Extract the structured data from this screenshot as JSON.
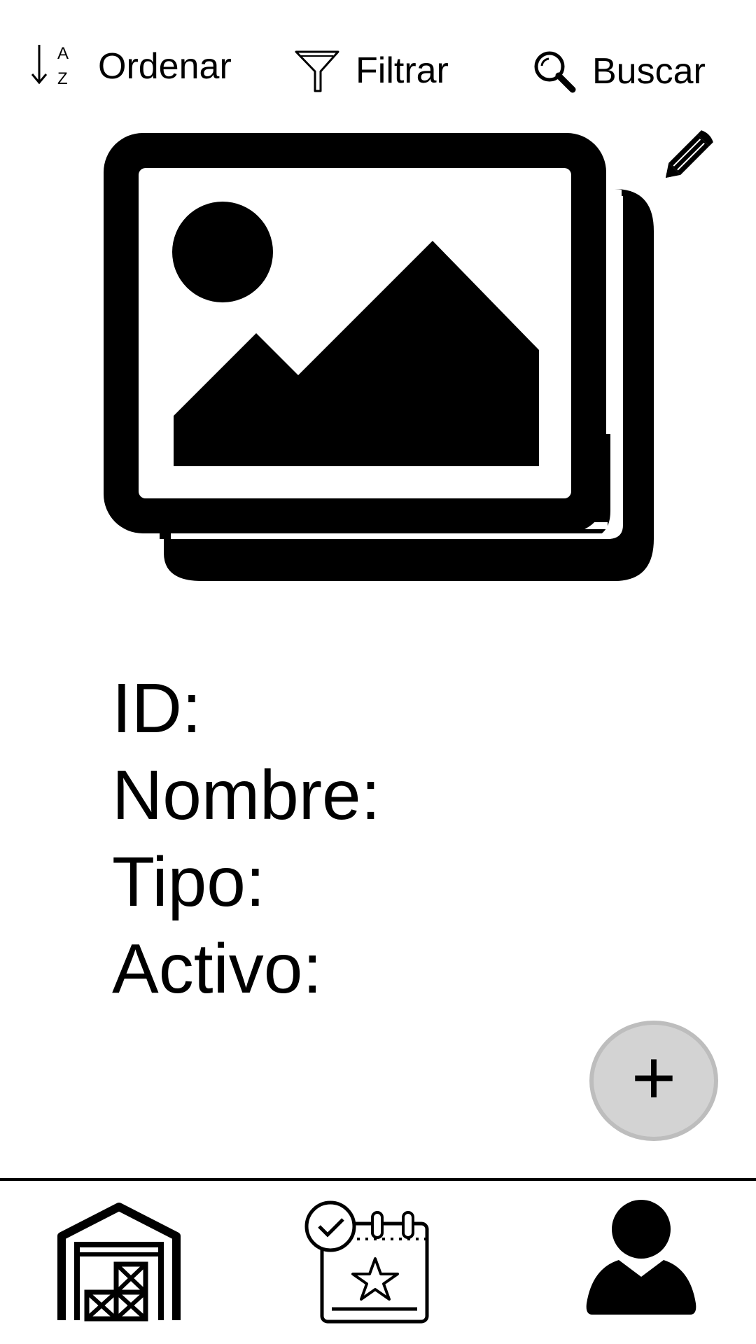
{
  "toolbar": {
    "sort_label": "Ordenar",
    "filter_label": "Filtrar",
    "search_label": "Buscar"
  },
  "details": {
    "id_label": "ID:",
    "name_label": "Nombre:",
    "type_label": "Tipo:",
    "active_label": "Activo:"
  },
  "fab": {
    "label": "+"
  },
  "icons": {
    "sort": "sort-az-icon",
    "filter": "funnel-icon",
    "search": "magnifier-icon",
    "edit": "pencil-icon",
    "image": "image-gallery-icon",
    "nav_warehouse": "warehouse-icon",
    "nav_events": "calendar-star-icon",
    "nav_profile": "user-icon"
  },
  "colors": {
    "fab_bg": "#d3d3d3",
    "fab_border": "#bdbdbd",
    "text": "#000000"
  }
}
